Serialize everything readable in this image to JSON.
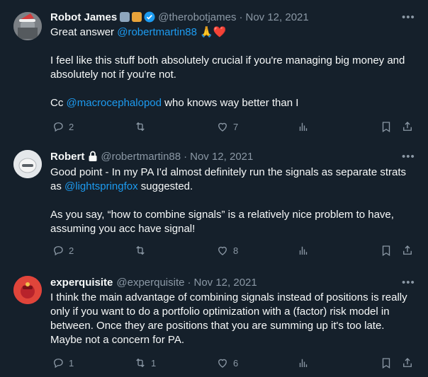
{
  "tweets": [
    {
      "name": "Robot James",
      "badges": [
        "robot-emoji",
        "beach-emoji",
        "verified-badge"
      ],
      "handle": "@therobotjames",
      "date": "Nov 12, 2021",
      "line1_text": "Great answer ",
      "line1_mention": "@robertmartin88",
      "line1_emoji": "🙏❤️",
      "para2": "I feel like this stuff both absolutely crucial if you're managing big money and absolutely not if you're not.",
      "para3_pre": "Cc ",
      "para3_mention": "@macrocephalopod",
      "para3_post": " who knows way better than I",
      "replies": "2",
      "retweets": "",
      "likes": "7"
    },
    {
      "name": "Robert",
      "badges": [
        "lock-icon"
      ],
      "handle": "@robertmartin88",
      "date": "Nov 12, 2021",
      "para1_pre": "Good point - In my PA I'd almost definitely run the signals as separate strats as ",
      "para1_mention": "@lightspringfox",
      "para1_post": " suggested.",
      "para2": "As you say, “how to combine signals” is a relatively nice problem to have, assuming you acc have signal!",
      "replies": "2",
      "retweets": "",
      "likes": "8"
    },
    {
      "name": "experquisite",
      "badges": [],
      "handle": "@experquisite",
      "date": "Nov 12, 2021",
      "para1": "I think the main advantage of combining signals instead of positions is really only if you want to do a portfolio optimization with a (factor) risk model in between. Once they are positions that you are summing up it's too late. Maybe not a concern for PA.",
      "replies": "1",
      "retweets": "1",
      "likes": "6"
    }
  ],
  "more_label": "•••",
  "colors": {
    "background": "#15202b",
    "text": "#f7f9f9",
    "muted": "#8b98a5",
    "link": "#1d9bf0"
  }
}
